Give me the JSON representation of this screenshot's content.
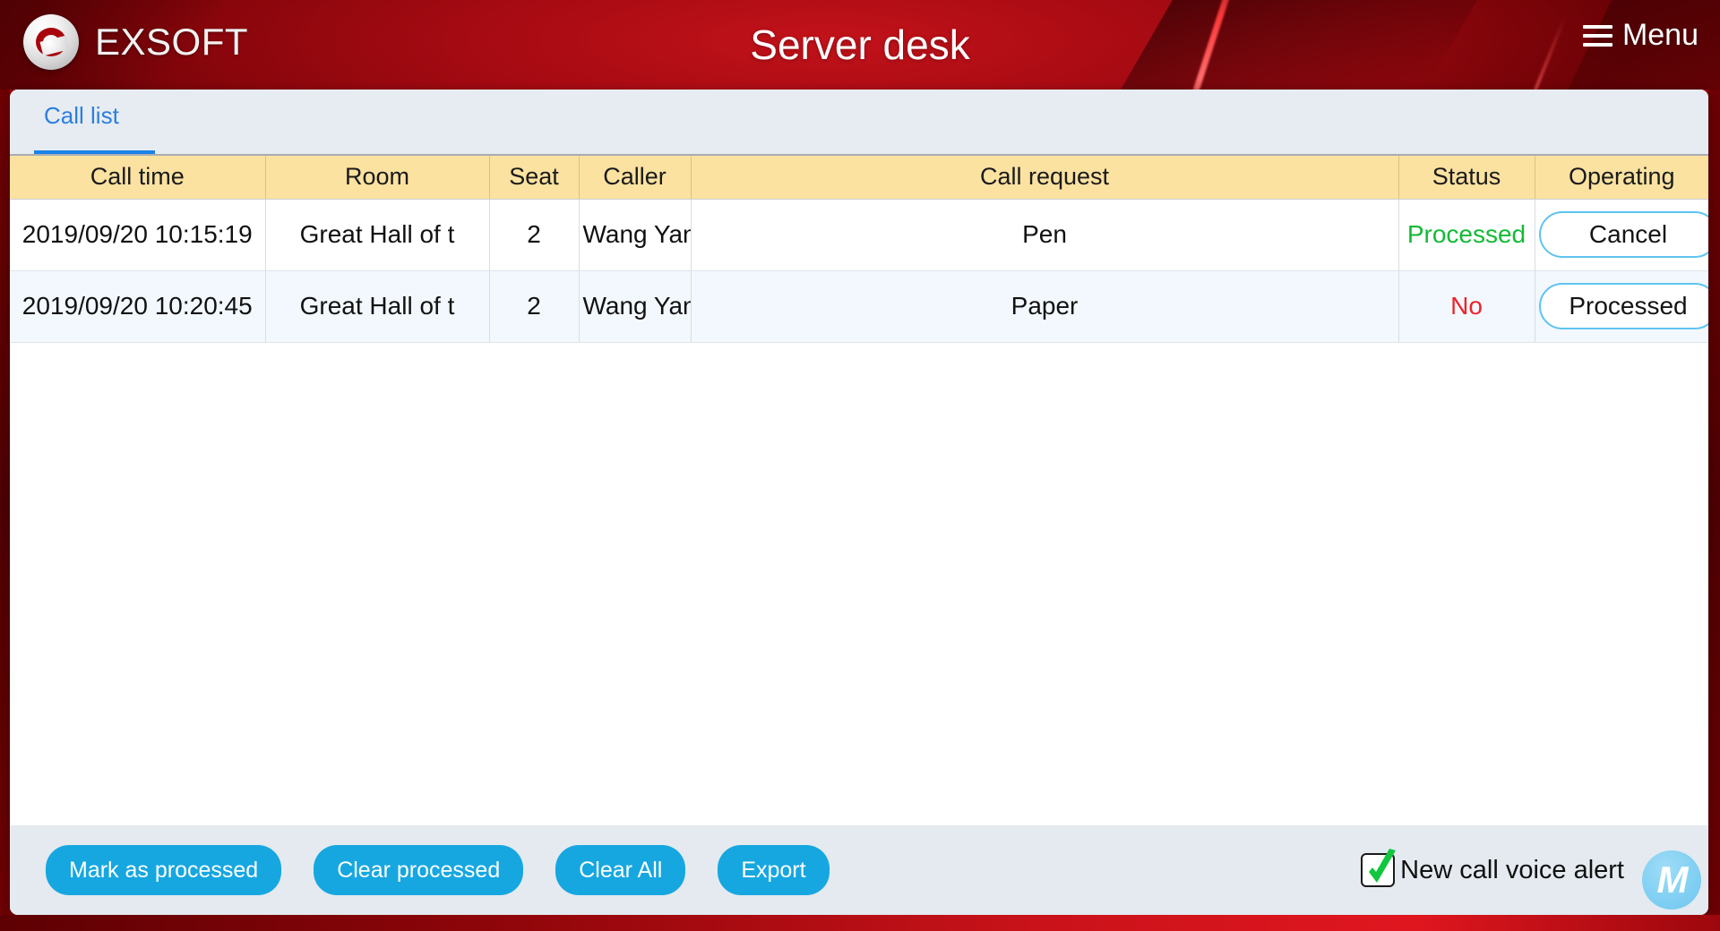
{
  "header": {
    "brand": "EXSOFT",
    "title": "Server desk",
    "menu_label": "Menu",
    "brand_color": "#a8060c",
    "logo_icon": "exsoft-e-logo-icon",
    "menu_icon": "hamburger-icon"
  },
  "tabs": [
    {
      "label": "Call list",
      "active": true
    }
  ],
  "table": {
    "columns": [
      "Call time",
      "Room",
      "Seat",
      "Caller",
      "Call request",
      "Status",
      "Operating"
    ],
    "rows": [
      {
        "call_time": "2019/09/20 10:15:19",
        "room": "Great Hall of t",
        "seat": "2",
        "caller": "Wang Yan",
        "call_request": "Pen",
        "status": "Processed",
        "status_color": "#13ba36",
        "operating": "Cancel"
      },
      {
        "call_time": "2019/09/20 10:20:45",
        "room": "Great Hall of t",
        "seat": "2",
        "caller": "Wang Yan",
        "call_request": "Paper",
        "status": "No",
        "status_color": "#f0222b",
        "operating": "Processed"
      }
    ]
  },
  "footer": {
    "buttons": [
      "Mark as processed",
      "Clear processed",
      "Clear All",
      "Export"
    ],
    "voice_alert_label": "New call voice alert",
    "voice_alert_checked": true,
    "badge_label": "M",
    "button_color": "#16a7e0"
  }
}
